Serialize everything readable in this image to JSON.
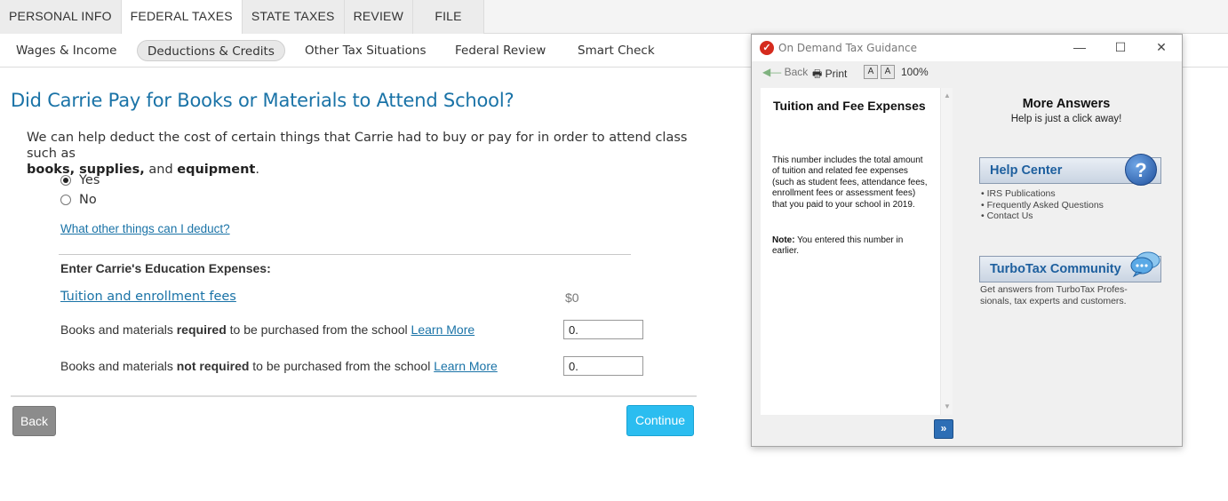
{
  "top_tabs": [
    {
      "label": "PERSONAL INFO"
    },
    {
      "label": "FEDERAL TAXES"
    },
    {
      "label": "STATE TAXES"
    },
    {
      "label": "REVIEW"
    },
    {
      "label": "FILE"
    }
  ],
  "sub_nav": [
    {
      "label": "Wages & Income"
    },
    {
      "label": "Deductions & Credits"
    },
    {
      "label": "Other Tax Situations"
    },
    {
      "label": "Federal Review"
    },
    {
      "label": "Smart Check"
    }
  ],
  "main": {
    "title": "Did Carrie Pay for Books or Materials to Attend School?",
    "intro_text": "We can help deduct the cost of certain things that Carrie had to buy or pay for in order to attend class such as",
    "intro_bold_1": "books, supplies,",
    "intro_and": "and",
    "intro_bold_2": "equipment",
    "intro_end": ".",
    "radio_yes": "Yes",
    "radio_no": "No",
    "deduct_link": "What other things can I deduct?",
    "edu_heading": "Enter Carrie's Education Expenses:",
    "tuition_link": "Tuition and enrollment fees",
    "tuition_value": "$0",
    "row1_pre": "Books and materials",
    "row1_bold": "required",
    "row1_post": "to be purchased from the school",
    "row1_link": "Learn More",
    "row1_value": "0.",
    "row2_pre": "Books and materials",
    "row2_bold": "not required",
    "row2_post": "to be purchased from the school",
    "row2_link": "Learn More",
    "row2_value": "0.",
    "back_label": "Back",
    "continue_label": "Continue"
  },
  "guidance": {
    "window_title": "On Demand Tax Guidance",
    "back_label": "Back",
    "print_label": "Print",
    "font_small": "A",
    "font_large": "A",
    "zoom": "100%",
    "heading": "Tuition and Fee Expenses",
    "body": "This number includes the total amount of tuition and related fee expenses (such as student fees, attendance fees, enrollment fees or assessment fees) that you paid to your school in 2019.",
    "note_label": "Note:",
    "note_text": "You entered this number in earlier.",
    "next_label": "»",
    "more_title": "More Answers",
    "more_sub": "Help is just a click away!",
    "help_center_label": "Help Center",
    "help_links": [
      "IRS Publications",
      "Frequently Asked Questions",
      "Contact Us"
    ],
    "community_label": "TurboTax Community",
    "community_desc_1": "Get answers from TurboTax Profes-",
    "community_desc_2": "sionals, tax experts and customers."
  },
  "colors": {
    "brand_blue": "#1a73a7",
    "continue_blue": "#2bbdf0",
    "back_gray": "#8c8c8c",
    "guidance_red": "#d52b1e"
  }
}
